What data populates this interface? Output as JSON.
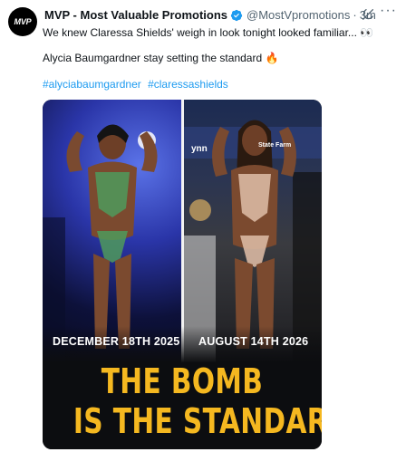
{
  "post": {
    "avatar_text": "MVP",
    "author_name": "MVP - Most Valuable Promotions",
    "handle": "@MostVpromotions",
    "separator": "·",
    "time": "3m",
    "more_label": "···",
    "line1": "We knew Claressa Shields' weigh in look tonight looked familiar... 👀",
    "line2": "Alycia Baumgardner stay setting the standard 🔥",
    "hashtags": [
      "#alyciabaumgardner",
      "#claressashields"
    ]
  },
  "image": {
    "date_left": "DECEMBER 18TH 2025",
    "date_right": "AUGUST 14TH 2026",
    "headline_line1": "THE BOMB",
    "headline_line2": "IS THE STANDARD",
    "banner_left": "ynn",
    "banner_right": "State Farm",
    "accent_color": "#f5b820"
  },
  "colors": {
    "link": "#1d9bf0",
    "verified": "#1d9bf0",
    "muted": "#536471"
  }
}
